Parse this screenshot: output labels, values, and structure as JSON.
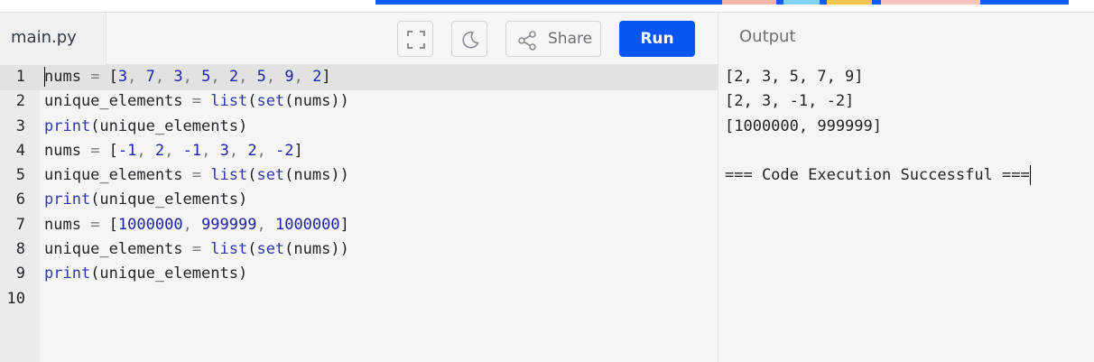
{
  "editor": {
    "filename": "main.py",
    "lines": [
      {
        "num": "1",
        "tokens": [
          {
            "t": "nums ",
            "c": "plain"
          },
          {
            "t": "= ",
            "c": "op"
          },
          {
            "t": "[",
            "c": "plain"
          },
          {
            "t": "3",
            "c": "num"
          },
          {
            "t": ", ",
            "c": "op"
          },
          {
            "t": "7",
            "c": "num"
          },
          {
            "t": ", ",
            "c": "op"
          },
          {
            "t": "3",
            "c": "num"
          },
          {
            "t": ", ",
            "c": "op"
          },
          {
            "t": "5",
            "c": "num"
          },
          {
            "t": ", ",
            "c": "op"
          },
          {
            "t": "2",
            "c": "num"
          },
          {
            "t": ", ",
            "c": "op"
          },
          {
            "t": "5",
            "c": "num"
          },
          {
            "t": ", ",
            "c": "op"
          },
          {
            "t": "9",
            "c": "num"
          },
          {
            "t": ", ",
            "c": "op"
          },
          {
            "t": "2",
            "c": "num"
          },
          {
            "t": "]",
            "c": "plain"
          }
        ]
      },
      {
        "num": "2",
        "tokens": [
          {
            "t": "unique_elements ",
            "c": "plain"
          },
          {
            "t": "= ",
            "c": "op"
          },
          {
            "t": "list",
            "c": "kw"
          },
          {
            "t": "(",
            "c": "plain"
          },
          {
            "t": "set",
            "c": "kw"
          },
          {
            "t": "(nums))",
            "c": "plain"
          }
        ]
      },
      {
        "num": "3",
        "tokens": [
          {
            "t": "print",
            "c": "kw"
          },
          {
            "t": "(unique_elements)",
            "c": "plain"
          }
        ]
      },
      {
        "num": "4",
        "tokens": [
          {
            "t": "nums ",
            "c": "plain"
          },
          {
            "t": "= ",
            "c": "op"
          },
          {
            "t": "[",
            "c": "plain"
          },
          {
            "t": "-1",
            "c": "num"
          },
          {
            "t": ", ",
            "c": "op"
          },
          {
            "t": "2",
            "c": "num"
          },
          {
            "t": ", ",
            "c": "op"
          },
          {
            "t": "-1",
            "c": "num"
          },
          {
            "t": ", ",
            "c": "op"
          },
          {
            "t": "3",
            "c": "num"
          },
          {
            "t": ", ",
            "c": "op"
          },
          {
            "t": "2",
            "c": "num"
          },
          {
            "t": ", ",
            "c": "op"
          },
          {
            "t": "-2",
            "c": "num"
          },
          {
            "t": "]",
            "c": "plain"
          }
        ]
      },
      {
        "num": "5",
        "tokens": [
          {
            "t": "unique_elements ",
            "c": "plain"
          },
          {
            "t": "= ",
            "c": "op"
          },
          {
            "t": "list",
            "c": "kw"
          },
          {
            "t": "(",
            "c": "plain"
          },
          {
            "t": "set",
            "c": "kw"
          },
          {
            "t": "(nums))",
            "c": "plain"
          }
        ]
      },
      {
        "num": "6",
        "tokens": [
          {
            "t": "print",
            "c": "kw"
          },
          {
            "t": "(unique_elements)",
            "c": "plain"
          }
        ]
      },
      {
        "num": "7",
        "tokens": [
          {
            "t": "nums ",
            "c": "plain"
          },
          {
            "t": "= ",
            "c": "op"
          },
          {
            "t": "[",
            "c": "plain"
          },
          {
            "t": "1000000",
            "c": "num"
          },
          {
            "t": ", ",
            "c": "op"
          },
          {
            "t": "999999",
            "c": "num"
          },
          {
            "t": ", ",
            "c": "op"
          },
          {
            "t": "1000000",
            "c": "num"
          },
          {
            "t": "]",
            "c": "plain"
          }
        ]
      },
      {
        "num": "8",
        "tokens": [
          {
            "t": "unique_elements ",
            "c": "plain"
          },
          {
            "t": "= ",
            "c": "op"
          },
          {
            "t": "list",
            "c": "kw"
          },
          {
            "t": "(",
            "c": "plain"
          },
          {
            "t": "set",
            "c": "kw"
          },
          {
            "t": "(nums))",
            "c": "plain"
          }
        ]
      },
      {
        "num": "9",
        "tokens": [
          {
            "t": "print",
            "c": "kw"
          },
          {
            "t": "(unique_elements)",
            "c": "plain"
          }
        ]
      },
      {
        "num": "10",
        "tokens": []
      }
    ]
  },
  "toolbar": {
    "fullscreen_icon": "fullscreen-icon",
    "theme_icon": "moon-icon",
    "share_icon": "share-icon",
    "share_label": "Share",
    "run_label": "Run",
    "run_color": "#0556f3"
  },
  "output": {
    "title": "Output",
    "lines": [
      "[2, 3, 5, 7, 9]",
      "[2, 3, -1, -2]",
      "[1000000, 999999]",
      "",
      "=== Code Execution Successful ==="
    ]
  }
}
